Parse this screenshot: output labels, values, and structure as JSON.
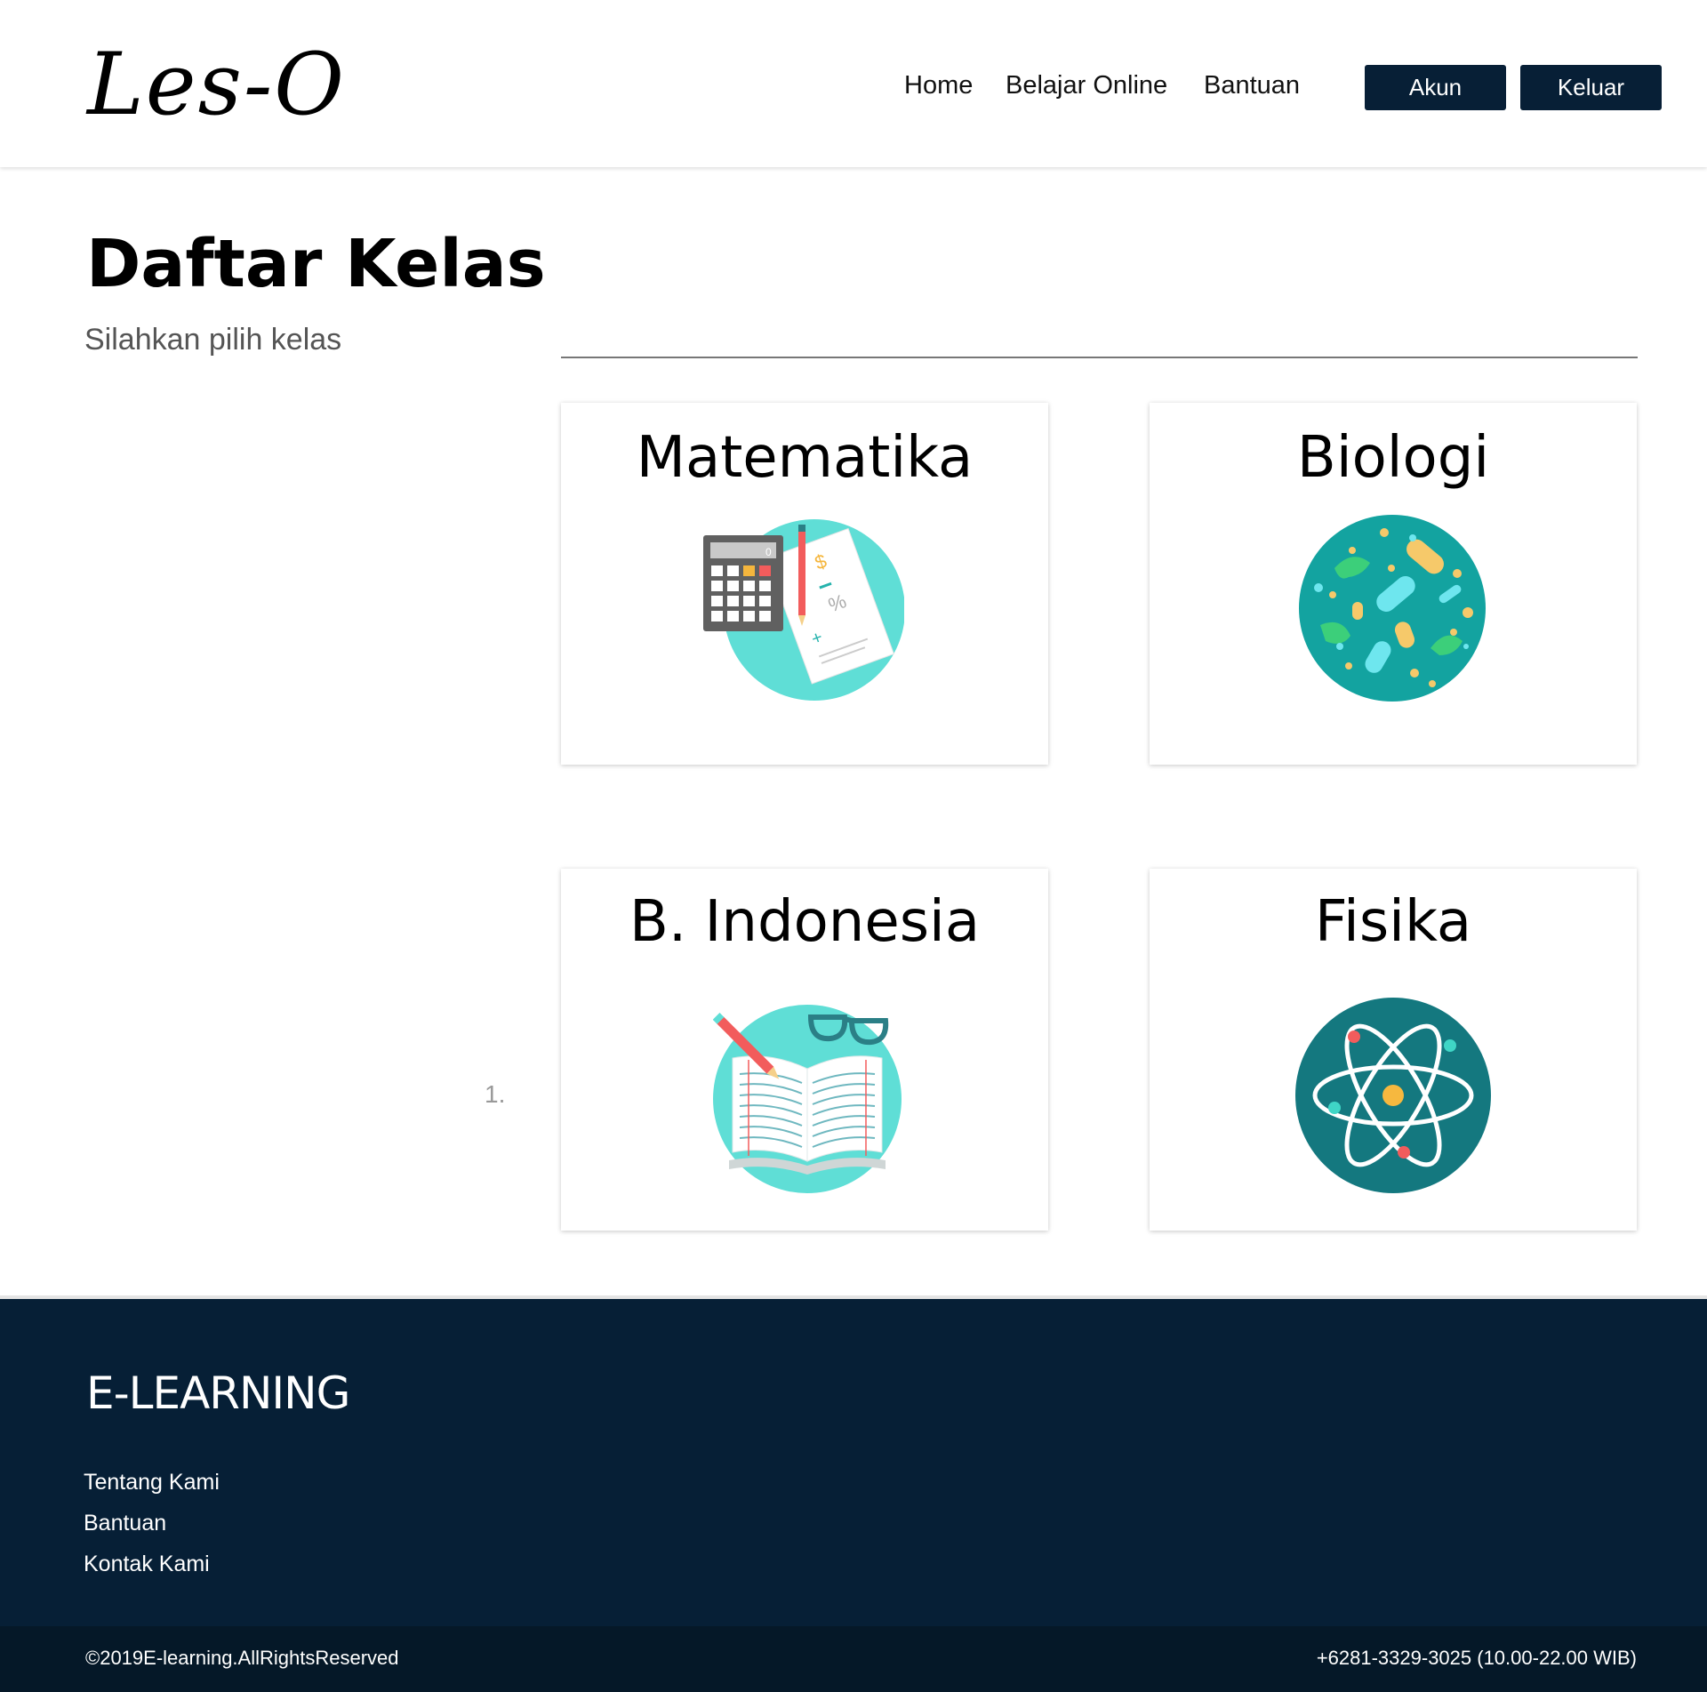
{
  "header": {
    "logo": "Les-O",
    "nav": {
      "home": "Home",
      "belajar_online": "Belajar Online",
      "bantuan": "Bantuan"
    },
    "buttons": {
      "akun": "Akun",
      "keluar": "Keluar"
    }
  },
  "main": {
    "title": "Daftar Kelas",
    "subtitle": "Silahkan pilih kelas",
    "list_marker": "1.",
    "classes": [
      {
        "name": "Matematika",
        "icon": "calculator-math-icon"
      },
      {
        "name": "Biologi",
        "icon": "bacteria-biology-icon"
      },
      {
        "name": "B. Indonesia",
        "icon": "open-book-icon"
      },
      {
        "name": "Fisika",
        "icon": "atom-physics-icon"
      }
    ]
  },
  "footer": {
    "title": "E-LEARNING",
    "links": [
      "Tentang Kami",
      "Bantuan",
      "Kontak Kami"
    ],
    "copyright": "©2019E-learning.AllRightsReserved",
    "phone": "+6281-3329-3025 (10.00-22.00 WIB)"
  },
  "colors": {
    "primary_dark": "#071f36",
    "footer_bg": "#061f36",
    "bottom_bar_bg": "#051828",
    "teal_light": "#5fded6",
    "teal_dark": "#14787f"
  }
}
